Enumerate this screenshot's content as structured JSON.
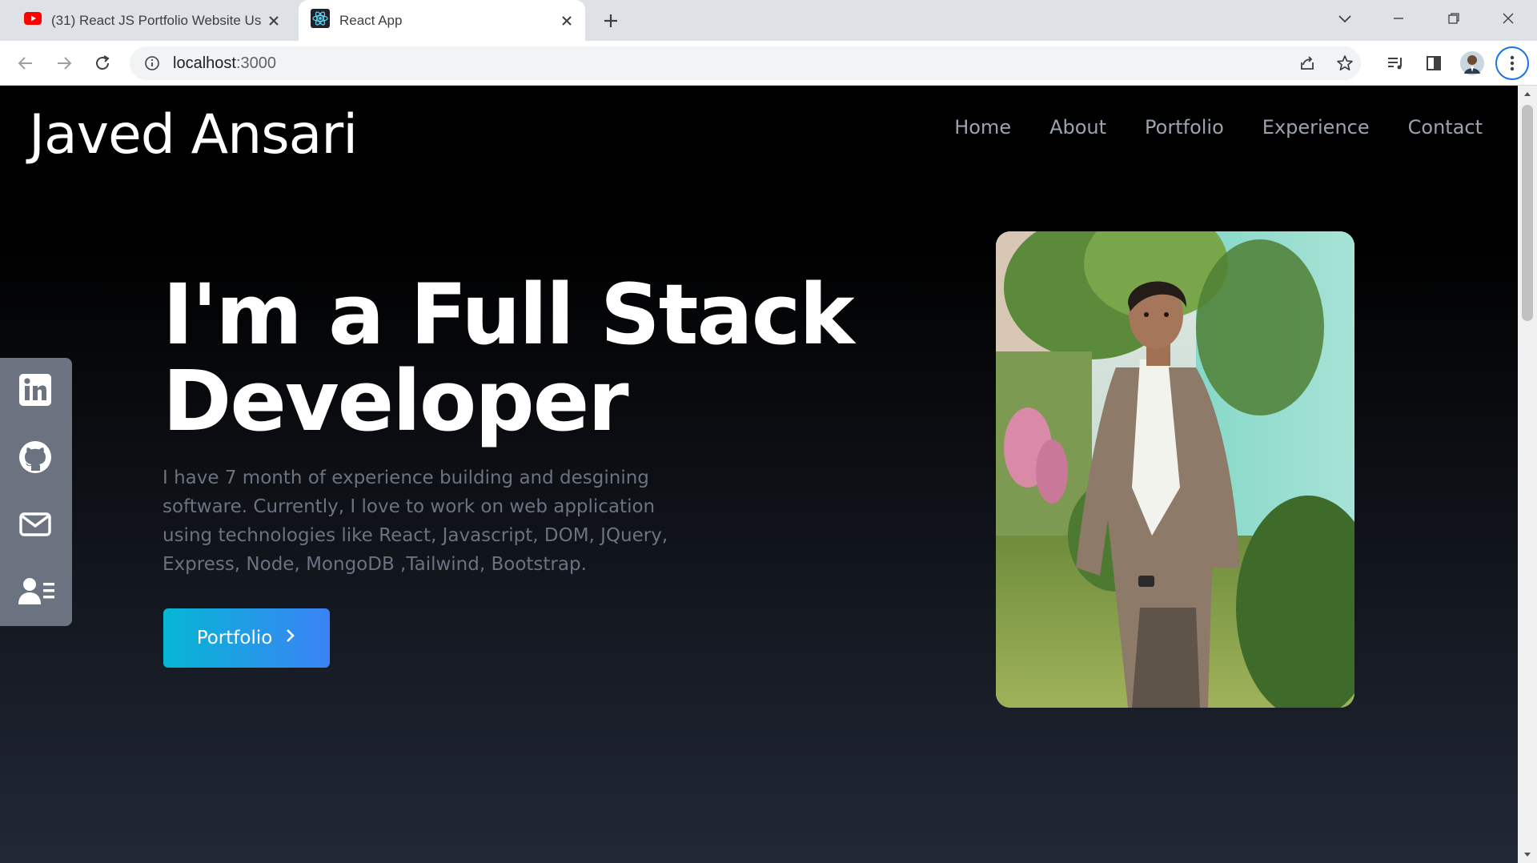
{
  "browser": {
    "tabs": [
      {
        "title": "(31) React JS Portfolio Website Us",
        "icon": "youtube-icon",
        "active": false
      },
      {
        "title": "React App",
        "icon": "react-icon",
        "active": true
      }
    ],
    "url_host": "localhost",
    "url_port": ":3000"
  },
  "page": {
    "brand": "Javed Ansari",
    "nav": [
      "Home",
      "About",
      "Portfolio",
      "Experience",
      "Contact"
    ],
    "hero": {
      "title_line1": "I'm a Full Stack",
      "title_line2": "Developer",
      "description": "I have 7 month of experience building and desgining software. Currently, I love to work on web application using technologies like React, Javascript, DOM, JQuery, Express, Node, MongoDB ,Tailwind, Bootstrap.",
      "cta_label": "Portfolio"
    },
    "social": [
      "linkedin-icon",
      "github-icon",
      "mail-icon",
      "resume-icon"
    ]
  },
  "colors": {
    "accent_from": "#06b6d4",
    "accent_to": "#3b82f6",
    "nav_text": "#9ca3af",
    "desc_text": "#6b7280",
    "social_bg": "#6b7280"
  }
}
